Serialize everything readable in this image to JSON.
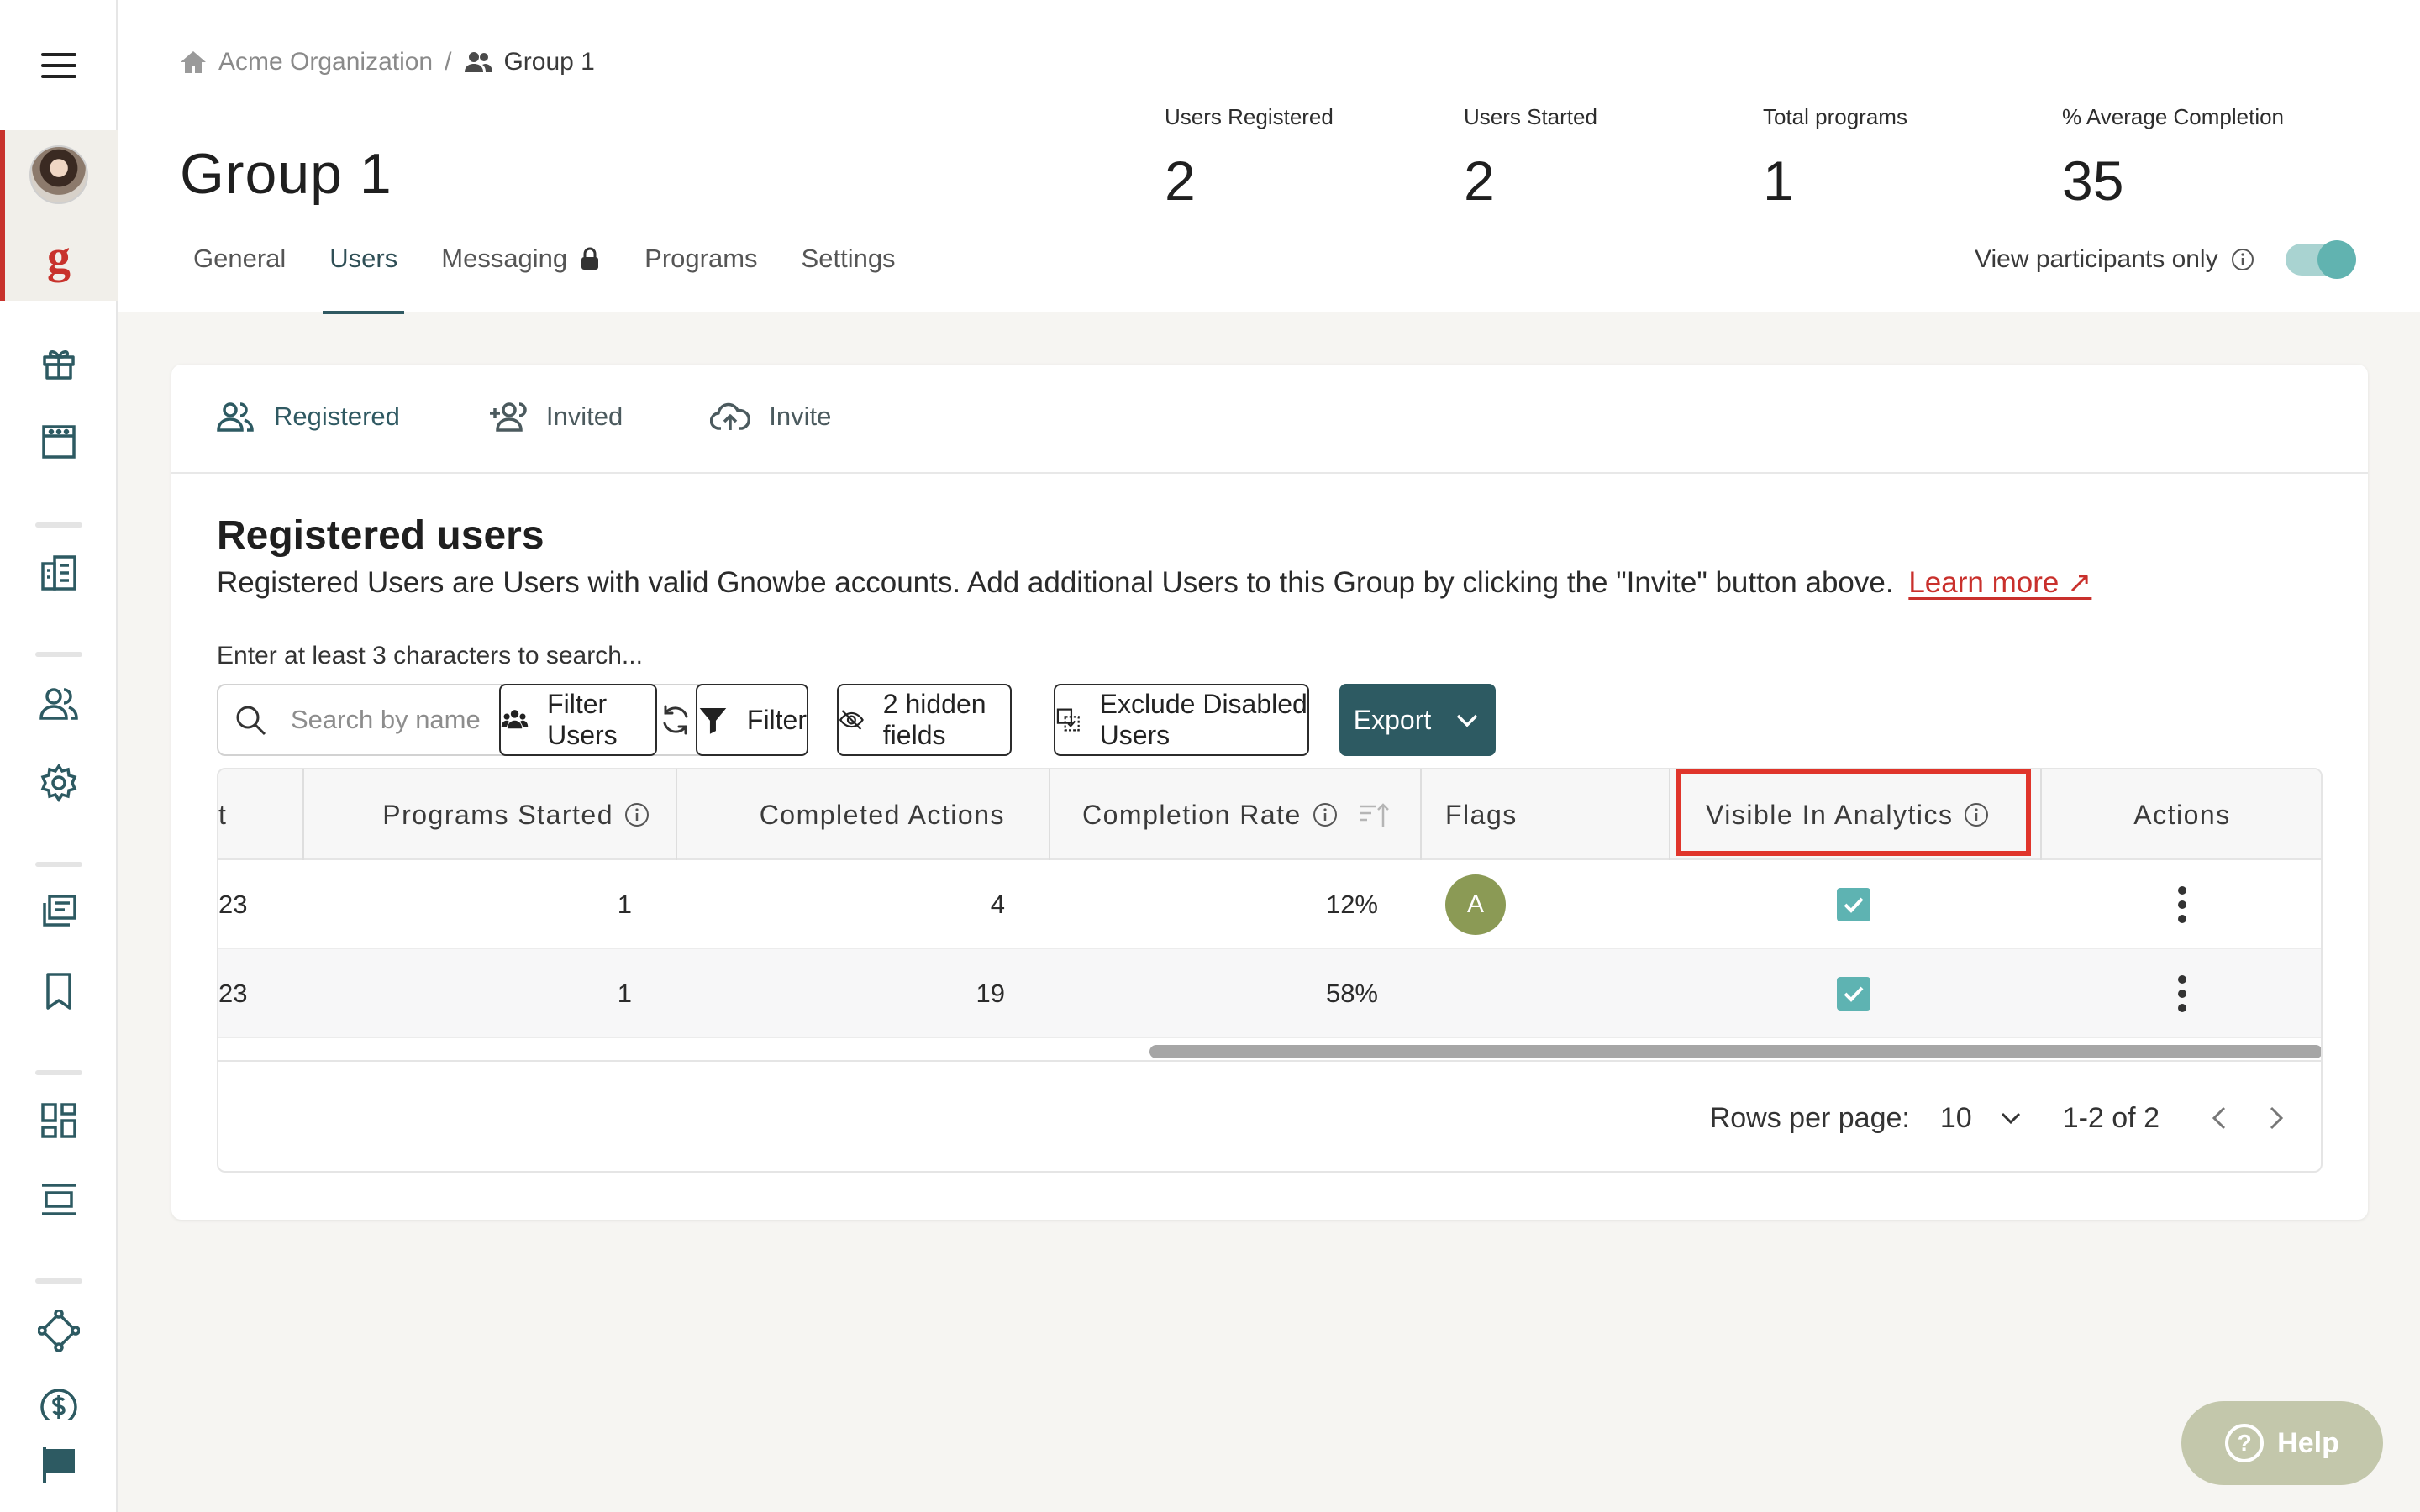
{
  "colors": {
    "accent": "#2d5a62",
    "brand_red": "#c8322c",
    "highlight": "#e0352b",
    "toggle": "#61b3b0",
    "checkbox": "#5eb3b2"
  },
  "sidebar": {
    "icons": [
      "menu-icon",
      "avatar",
      "gnowbe-logo-icon",
      "gift-icon",
      "calendar-icon",
      "building-icon",
      "users-icon",
      "gear-icon",
      "library-icon",
      "bookmark-icon",
      "dashboard-icon",
      "layout-icon",
      "network-icon",
      "dollar-icon",
      "flag-icon"
    ],
    "logo_letter": "g"
  },
  "breadcrumb": {
    "root": "Acme Organization",
    "separator": "/",
    "current": "Group 1"
  },
  "page": {
    "title": "Group 1"
  },
  "stats": [
    {
      "label": "Users Registered",
      "value": "2"
    },
    {
      "label": "Users Started",
      "value": "2"
    },
    {
      "label": "Total programs",
      "value": "1"
    },
    {
      "label": "% Average Completion",
      "value": "35"
    }
  ],
  "tabs": [
    {
      "label": "General",
      "active": false
    },
    {
      "label": "Users",
      "active": true
    },
    {
      "label": "Messaging",
      "active": false,
      "locked": true
    },
    {
      "label": "Programs",
      "active": false
    },
    {
      "label": "Settings",
      "active": false
    }
  ],
  "view_participants": {
    "label": "View participants only",
    "enabled": true
  },
  "subtabs": [
    {
      "label": "Registered",
      "icon": "users-icon",
      "active": true
    },
    {
      "label": "Invited",
      "icon": "user-plus-icon",
      "active": false
    },
    {
      "label": "Invite",
      "icon": "cloud-upload-icon",
      "active": false
    }
  ],
  "section": {
    "title": "Registered users",
    "description": "Registered Users are Users with valid Gnowbe accounts. Add additional Users to this Group by clicking the \"Invite\" button above.",
    "learn_more": "Learn more ↗",
    "search_hint": "Enter at least 3 characters to search..."
  },
  "search": {
    "placeholder": "Search by name",
    "value": ""
  },
  "toolbar": {
    "filter_users": "Filter Users",
    "filter": "Filter",
    "hidden_fields": "2 hidden fields",
    "exclude_disabled": "Exclude Disabled Users",
    "export": "Export"
  },
  "table": {
    "columns": {
      "truncated": "t",
      "programs_started": "Programs Started",
      "completed_actions": "Completed Actions",
      "completion_rate": "Completion Rate",
      "flags": "Flags",
      "visible_in_analytics": "Visible In Analytics",
      "actions": "Actions"
    },
    "rows": [
      {
        "truncated": "23",
        "programs_started": "1",
        "completed_actions": "4",
        "completion_rate": "12%",
        "flag": "A",
        "visible": true
      },
      {
        "truncated": "23",
        "programs_started": "1",
        "completed_actions": "19",
        "completion_rate": "58%",
        "flag": "",
        "visible": true
      }
    ]
  },
  "pagination": {
    "rows_per_page_label": "Rows per page:",
    "rows_per_page": "10",
    "range": "1-2 of 2"
  },
  "help": {
    "label": "Help"
  }
}
